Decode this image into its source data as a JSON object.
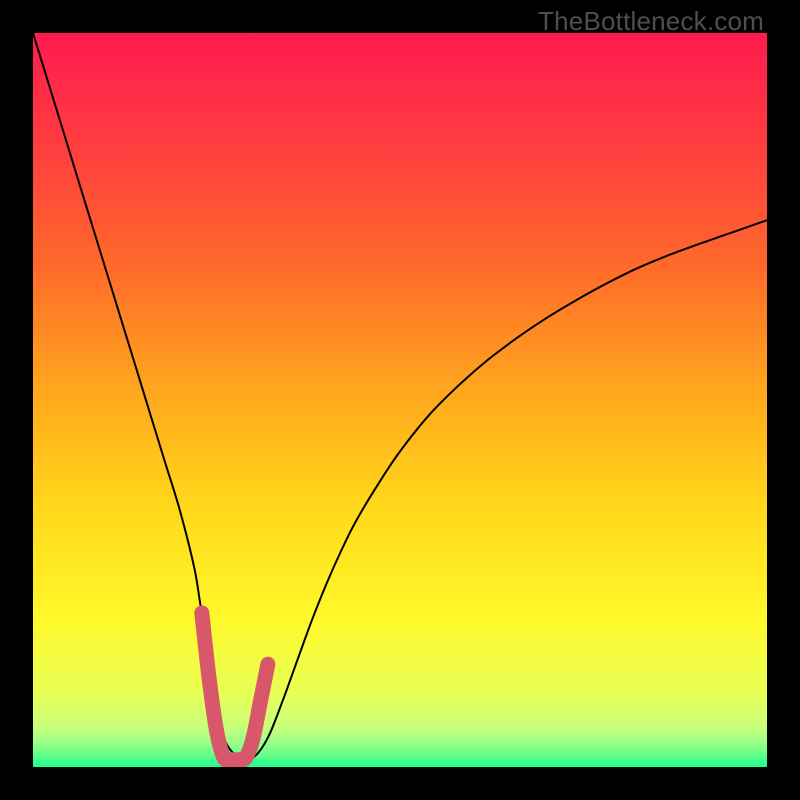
{
  "watermark": "TheBottleneck.com",
  "chart_data": {
    "type": "line",
    "title": "",
    "xlabel": "",
    "ylabel": "",
    "xlim": [
      0,
      100
    ],
    "ylim": [
      0,
      100
    ],
    "grid": false,
    "legend": false,
    "series": [
      {
        "name": "bottleneck-curve",
        "x": [
          0,
          2,
          4,
          6,
          8,
          10,
          12,
          14,
          16,
          18,
          20,
          22,
          23,
          25,
          26,
          28,
          30,
          32,
          34,
          36,
          38,
          40,
          42,
          44,
          47,
          50,
          54,
          58,
          62,
          66,
          70,
          74,
          78,
          82,
          86,
          90,
          94,
          98,
          100
        ],
        "y": [
          100,
          93.5,
          87,
          80.5,
          74,
          67.5,
          61,
          54.5,
          48,
          41.5,
          35,
          27,
          21,
          10,
          4,
          1.3,
          1.3,
          4,
          9,
          14.5,
          20,
          25,
          29.5,
          33.5,
          38.5,
          43,
          48,
          52,
          55.5,
          58.5,
          61.2,
          63.6,
          65.8,
          67.8,
          69.5,
          71,
          72.4,
          73.8,
          74.5
        ]
      },
      {
        "name": "optimal-range-marker",
        "x": [
          23,
          24,
          25,
          26,
          27,
          28,
          29,
          30,
          31,
          32
        ],
        "y": [
          21,
          12,
          5,
          1.3,
          1.0,
          1.0,
          1.3,
          4,
          9,
          14
        ]
      }
    ],
    "background_gradient": {
      "stops": [
        {
          "offset": 0.0,
          "color": "#ff1a4e"
        },
        {
          "offset": 0.16,
          "color": "#ff3f3f"
        },
        {
          "offset": 0.32,
          "color": "#ff6a2a"
        },
        {
          "offset": 0.48,
          "color": "#ffa41e"
        },
        {
          "offset": 0.64,
          "color": "#ffd61a"
        },
        {
          "offset": 0.8,
          "color": "#fff92a"
        },
        {
          "offset": 0.9,
          "color": "#e8ff55"
        },
        {
          "offset": 0.945,
          "color": "#c9ff7a"
        },
        {
          "offset": 0.965,
          "color": "#9fff88"
        },
        {
          "offset": 0.985,
          "color": "#5eff8a"
        },
        {
          "offset": 1.0,
          "color": "#1aff8f"
        }
      ]
    },
    "colors": {
      "curve": "#000000",
      "marker": "#d9576b"
    }
  }
}
